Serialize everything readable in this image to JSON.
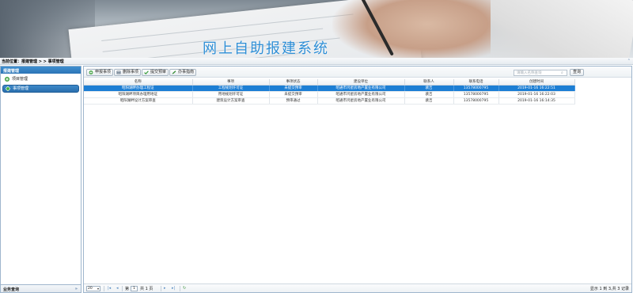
{
  "banner": {
    "title": "网上自助报建系统"
  },
  "breadcrumb": {
    "text": "当前位置：报建管理 > > 事项管理"
  },
  "sidebar": {
    "header": "报建管理",
    "items": [
      {
        "label": "项目管理",
        "active": false,
        "icon": "green-plus-icon"
      },
      {
        "label": "事项管理",
        "active": true,
        "icon": "green-diamond-icon"
      }
    ],
    "footer": "业务查询"
  },
  "toolbar": {
    "add_label": "申报事项",
    "delete_label": "删除事项",
    "submit_label": "提交预审",
    "guide_label": "办事指南",
    "search_placeholder": "请输入名称查询",
    "query_label": "查询"
  },
  "table": {
    "columns": [
      "名称",
      "事项",
      "事项状态",
      "建设单位",
      "联系人",
      "联系电话",
      "创建时间"
    ],
    "rows": [
      [
        "昭阳湖畔办理工程证",
        "工程规划许可证",
        "未提交预审",
        "昭通市鸿星房地产置业有限公司",
        "裴吉",
        "13578000795",
        "2019-01-16 16:22:51"
      ],
      [
        "昭阳湖畔项目办理用地证",
        "用地规划许可证",
        "未提交预审",
        "昭通市鸿星房地产置业有限公司",
        "裴吉",
        "13578000795",
        "2019-01-16 16:22:03"
      ],
      [
        "昭阳湖畔设计方案审查",
        "建筑设计方案审查",
        "预审通过",
        "昭通市鸿星房地产置业有限公司",
        "裴吉",
        "13578000795",
        "2019-01-16 16:14:35"
      ]
    ],
    "selected_row": 0
  },
  "pager": {
    "page_size": "20",
    "page_prefix": "第",
    "page_value": "1",
    "page_suffix": "共 1 页",
    "info": "显示 1 到 3,共 3 记录"
  },
  "colors": {
    "accent": "#1c7ed4",
    "title": "#2f8fd6",
    "sidebar_header": "#2c74b6"
  }
}
